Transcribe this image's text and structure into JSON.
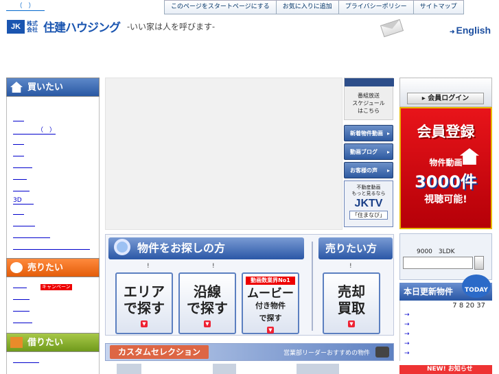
{
  "header": {
    "top_link": "（　）",
    "nav": [
      "このページをスタートページにする",
      "お気に入りに追加",
      "プライバシーポリシー",
      "サイトマップ"
    ],
    "logo_mark": "JK",
    "logo_kaisha": "株式\n会社",
    "logo_name": "住建ハウジング",
    "tagline": "-いい家は人を呼びます-",
    "english": "English"
  },
  "left": {
    "buy_title": "買いたい",
    "buy_items": [
      "",
      "（　）",
      "",
      "",
      "",
      "",
      "",
      "3D",
      "",
      "",
      "",
      ""
    ],
    "sell_title": "売りたい",
    "sell_items": [
      "キャンペーン",
      "",
      "",
      ""
    ],
    "rent_title": "借りたい",
    "rent_items": [
      ""
    ]
  },
  "video_panel": {
    "schedule": "番組放送\nスケジュール\nはこちら",
    "buttons": [
      "新着物件動画",
      "動画ブログ",
      "お客様の声"
    ],
    "jktv_text": "不動産動画\nもっと見るなら",
    "jktv_logo": "JKTV",
    "jktv_sub": "「住まなび」"
  },
  "search": {
    "title": "物件をお探しの方",
    "sell_title": "売りたい方",
    "ex_marks": [
      "!",
      "!",
      "!"
    ],
    "area_label": "エリア\nで探す",
    "line_label": "沿線\nで探す",
    "movie_top": "動画数業界No1",
    "movie_label": "ムービー",
    "movie_sub": "付き物件\nで探す",
    "sell_label": "売却\n買取"
  },
  "custom": {
    "title": "カスタムセレクション",
    "subtitle": "営業部リーダーおすすめの物件"
  },
  "right": {
    "login": "会員ログイン",
    "promo_title": "会員登録",
    "promo_movie": "物件動画",
    "promo_count": "3000件",
    "promo_end": "視聴可能!",
    "quick_label": "9000　3LDK",
    "update_title": "本日更新物件",
    "today": "TODAY",
    "update_date": "7 8 20 37",
    "update_arrows": [
      "→",
      "→",
      "→",
      "→",
      "→"
    ],
    "news": "NEW! お知らせ"
  }
}
